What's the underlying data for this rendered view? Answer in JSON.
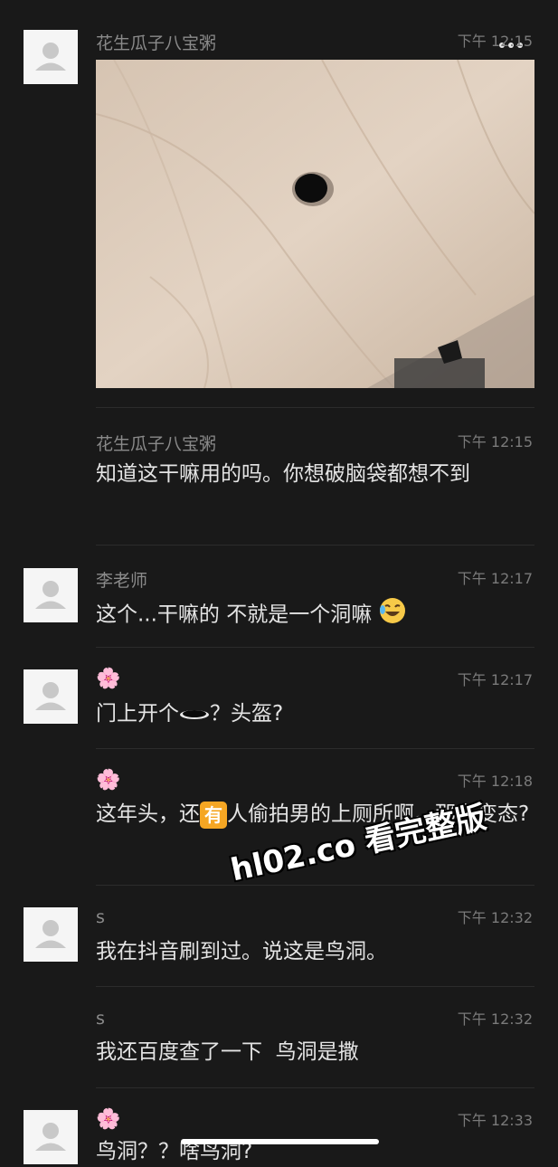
{
  "nav": {
    "back_icon": "chevron-left-icon",
    "more_icon": "more-dots-icon"
  },
  "messages": [
    {
      "name": "花生瓜子八宝粥",
      "time": "下午 12:15",
      "type": "image"
    },
    {
      "name": "花生瓜子八宝粥",
      "time": "下午 12:15",
      "text": "知道这干嘛用的吗。你想破脑袋都想不到"
    },
    {
      "name": "李老师",
      "time": "下午 12:17",
      "text": "这个...干嘛的 不就是一个洞嘛"
    },
    {
      "name": "🌸",
      "time": "下午 12:17",
      "text_a": "门上开个",
      "text_b": "？头盔?"
    },
    {
      "name": "🌸",
      "time": "下午 12:18",
      "text_a": "这年头，还",
      "badge": "有",
      "text_b": "人偷拍男的上厕所啊。那么变态?"
    },
    {
      "name": "s",
      "time": "下午 12:32",
      "text": "我在抖音刷到过。说这是鸟洞。"
    },
    {
      "name": "s",
      "time": "下午 12:32",
      "text": "我还百度查了一下  鸟洞是撒"
    },
    {
      "name": "🌸",
      "time": "下午 12:33",
      "text": "鸟洞？？啥鸟洞?"
    }
  ],
  "watermark": "hl02.co 看完整版",
  "colors": {
    "background": "#191919",
    "text": "#e4e4e4",
    "meta": "#8a8a8a",
    "badge": "#f5a623"
  }
}
